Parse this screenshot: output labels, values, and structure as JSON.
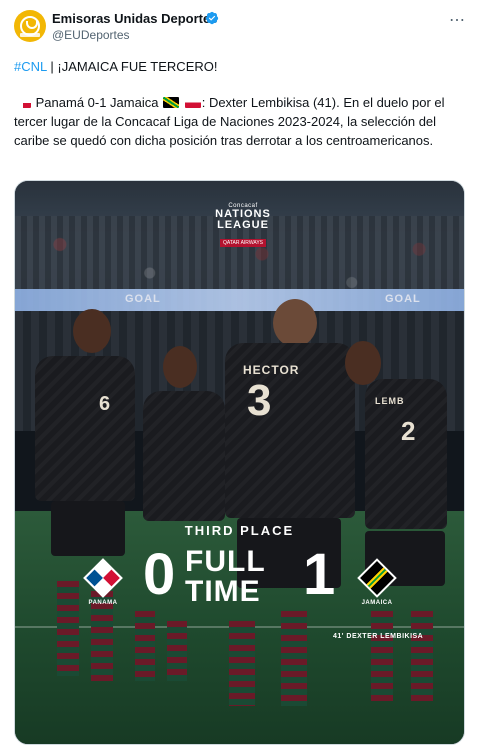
{
  "tweet": {
    "author_name": "Emisoras Unidas Deportes",
    "handle": "@EUDeportes",
    "hashtag": "#CNL",
    "headline": " | ¡JAMAICA FUE TERCERO!",
    "body_score": "Panamá 0-1 Jamaica",
    "body_rest": ": Dexter Lembikisa (41). En el duelo por el tercer lugar de la Concacaf Liga de Naciones 2023-2024, la selección del caribe se quedó con dicha posición tras derrotar a los centroamericanos.",
    "more_icon": "⋯"
  },
  "media": {
    "logo_small": "Concacaf",
    "logo_line1": "NATIONS",
    "logo_line2": "LEAGUE",
    "logo_tag": "QATAR AIRWAYS",
    "board_left": "GOAL",
    "board_right": "GOAL",
    "jersey_left_number": "6",
    "jersey_center_name": "HECTOR",
    "jersey_center_number": "3",
    "jersey_right_name": "LEMB",
    "jersey_right_number": "2",
    "stage": "THIRD PLACE",
    "score_home": "0",
    "score_away": "1",
    "status_line1": "FULL",
    "status_line2": "TIME",
    "home_team": "PANAMA",
    "away_team": "JAMAICA",
    "scorer": "41' DEXTER LEMBIKISA"
  },
  "colors": {
    "link": "#1d9bf0",
    "verified": "#1d9bf0",
    "brand_avatar": "#f2b705"
  }
}
